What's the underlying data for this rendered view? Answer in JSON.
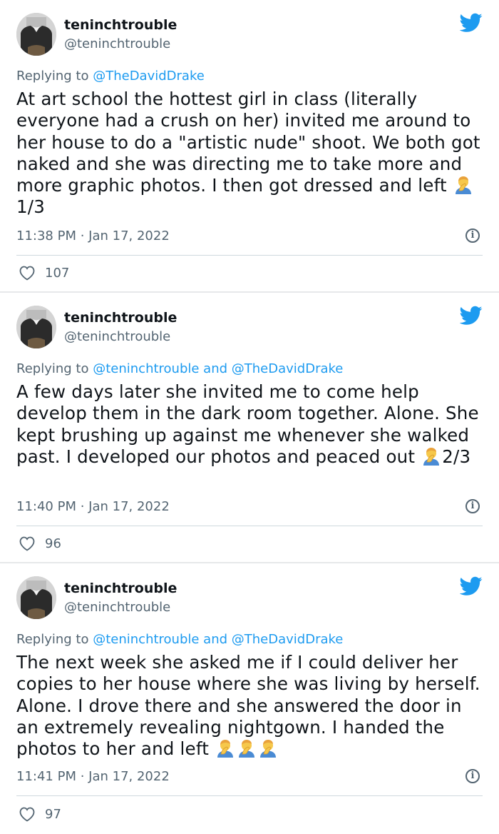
{
  "colors": {
    "twitter_blue": "#1d9bf0",
    "text": "#0f1419",
    "secondary_text": "#536471",
    "divider": "#cfd9de"
  },
  "icons": {
    "bird": "twitter-bird-icon",
    "info": "info-icon",
    "like": "heart-icon",
    "emoji": "person-facepalming-emoji"
  },
  "tweets": [
    {
      "display_name": "teninchtrouble",
      "handle": "@teninchtrouble",
      "reply_prefix": "Replying to",
      "reply_mentions": "@TheDavidDrake",
      "text": "At art school the hottest girl in class (literally everyone had a crush on her) invited me around to her house to do a \"artistic nude\" shoot. We both got naked and she was directing me to take more and more graphic photos. I then got dressed and left",
      "suffix": "1/3",
      "timestamp": "11:38 PM · Jan 17, 2022",
      "likes": "107"
    },
    {
      "display_name": "teninchtrouble",
      "handle": "@teninchtrouble",
      "reply_prefix": "Replying to",
      "reply_mentions": "@teninchtrouble and @TheDavidDrake",
      "text": "A few days later she invited me to come help develop them in the dark room together. Alone. She kept brushing up against me whenever she walked past. I developed our photos and peaced out",
      "suffix": "2/3",
      "timestamp": "11:40 PM · Jan 17, 2022",
      "likes": "96"
    },
    {
      "display_name": "teninchtrouble",
      "handle": "@teninchtrouble",
      "reply_prefix": "Replying to",
      "reply_mentions": "@teninchtrouble and @TheDavidDrake",
      "text": "The next week she asked me if I could deliver her copies to her house where she was living by herself. Alone. I drove there and she answered the door in an extremely revealing nightgown. I handed the photos to her and left",
      "suffix": "",
      "timestamp": "11:41 PM · Jan 17, 2022",
      "likes": "97"
    }
  ]
}
